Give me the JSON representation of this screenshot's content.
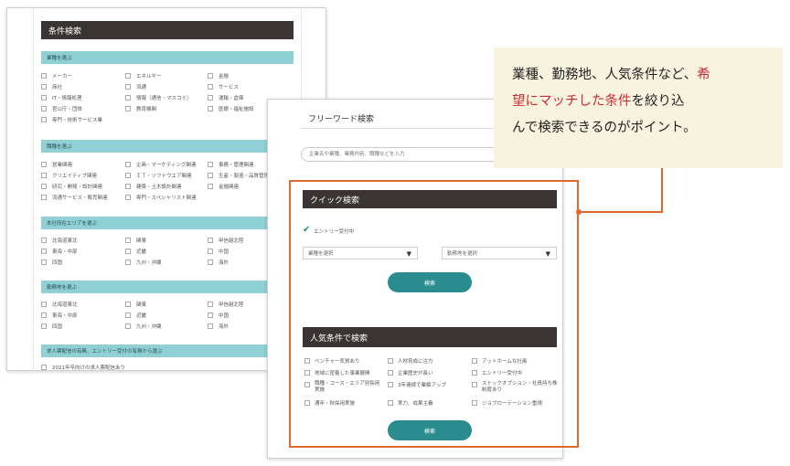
{
  "back": {
    "title": "条件検索",
    "sections": [
      {
        "header": "業種を選ぶ",
        "items": [
          [
            "メーカー",
            "エネルギー",
            "金融"
          ],
          [
            "商社",
            "流通",
            "サービス"
          ],
          [
            "IT・情報処理",
            "情報（通信・マスコミ）",
            "運輸・倉庫"
          ],
          [
            "官公庁・団体",
            "教育機関",
            "医療・福祉施設"
          ],
          [
            "専門・技術サービス業"
          ]
        ]
      },
      {
        "header": "職種を選ぶ",
        "items": [
          [
            "営業関連",
            "企画・マーケティング関連",
            "事務・管理関連"
          ],
          [
            "クリエイティブ関連",
            "ＩＴ・ソフトウエア関連",
            "生産・製造・品質管理"
          ],
          [
            "研究・開発・設計関連",
            "建築・土木設計関連",
            "金融関連"
          ],
          [
            "流通サービス・販売関連",
            "専門・スペシャリスト関連"
          ]
        ]
      },
      {
        "header": "本社所在エリアを選ぶ",
        "items": [
          [
            "北海道東北",
            "関東",
            "甲信越北陸"
          ],
          [
            "東海・中部",
            "近畿",
            "中国"
          ],
          [
            "四国",
            "九州・沖縄",
            "海外"
          ]
        ]
      },
      {
        "header": "勤務地を選ぶ",
        "items": [
          [
            "北海道東北",
            "関東",
            "甲信越北陸"
          ],
          [
            "東海・中部",
            "近畿",
            "中国"
          ],
          [
            "四国",
            "九州・沖縄",
            "海外"
          ]
        ]
      },
      {
        "header": "求人票配信の有無、エントリー受付の有無から選ぶ",
        "items": [
          [
            "2021年卒向けの求人票配信あり"
          ]
        ]
      }
    ]
  },
  "front": {
    "freeword_title": "フリーワード検索",
    "freeword_placeholder": "企業名や業種、業務内容、職種などを入力",
    "quick_title": "クイック検索",
    "entry_label": "エントリー受付中",
    "industry_select": "業種を選択",
    "location_select": "勤務地を選択",
    "search_button": "検索",
    "popular_title": "人気条件で検索",
    "popular_items": [
      [
        "ベンチャー気質あり",
        "人材育成に注力",
        "アットホームな社風"
      ],
      [
        "地域に密着した事業展開",
        "企業歴史が長い",
        "エントリー受付中"
      ],
      [
        "職種・コース・エリア別採用実施",
        "3年連続で業績アップ",
        "ストックオプション・社員持ち株制度あり"
      ],
      [
        "通年・秋採用実施",
        "実力、成果主義",
        "ジョブローテーション重視"
      ]
    ],
    "search_button2": "検索"
  },
  "callout": {
    "line1_a": "業種、勤務地、人気条件など、",
    "line1_b": "希",
    "line2_a": "望にマッチした",
    "line2_b": "条件",
    "line2_c": "を絞り込",
    "line3": "んで検索できるのがポイント。"
  },
  "colors": {
    "title_bar": "#3a3533",
    "teal_bar": "#8fd0d7",
    "button": "#2a8c8f",
    "highlight_border": "#e06a2a",
    "callout_bg": "#f8f3df",
    "callout_highlight": "#cc2a33"
  }
}
